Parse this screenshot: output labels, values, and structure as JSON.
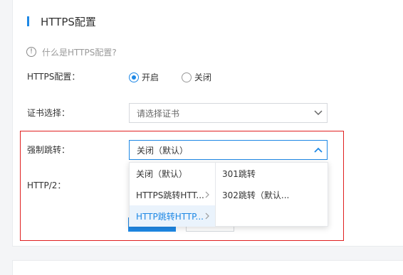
{
  "section": {
    "title": "HTTPS配置"
  },
  "help": {
    "icon": "question-circle-icon",
    "text": "什么是HTTPS配置?"
  },
  "https_config": {
    "label": "HTTPS配置：",
    "options": [
      {
        "label": "开启",
        "checked": true
      },
      {
        "label": "关闭",
        "checked": false
      }
    ]
  },
  "certificate": {
    "label": "证书选择：",
    "placeholder": "请选择证书"
  },
  "force_redirect": {
    "label": "强制跳转：",
    "value": "关闭（默认）",
    "menu_level1": [
      {
        "label": "关闭（默认）",
        "has_submenu": false,
        "selected": false
      },
      {
        "label": "HTTPS跳转HTT...",
        "has_submenu": true,
        "selected": false
      },
      {
        "label": "HTTP跳转HTTP...",
        "has_submenu": true,
        "selected": true
      }
    ],
    "menu_level2": [
      {
        "label": "301跳转"
      },
      {
        "label": "302跳转（默认..."
      }
    ]
  },
  "http2": {
    "label": "HTTP/2："
  },
  "colors": {
    "accent": "#1e88e5",
    "highlight_border": "#e02020"
  }
}
